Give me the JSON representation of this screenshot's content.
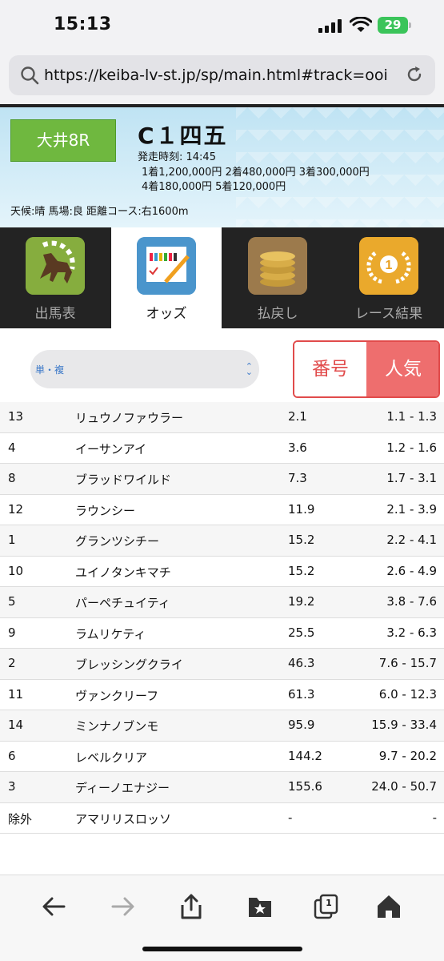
{
  "status": {
    "time": "15:13",
    "battery": "29"
  },
  "browser": {
    "url": "https://keiba-lv-st.jp/sp/main.html#track=ooi"
  },
  "race": {
    "badge": "大井8R",
    "name": "C１四五",
    "start": "発走時刻: 14:45",
    "prize_line1": "1着1,200,000円  2着480,000円  3着300,000円",
    "prize_line2": "4着180,000円  5着120,000円",
    "conditions": "天候:晴 馬場:良   距離コース:右1600m"
  },
  "tabs": [
    {
      "label": "出馬表",
      "icon": "horse-icon",
      "active": false
    },
    {
      "label": "オッズ",
      "icon": "odds-sheet-icon",
      "active": true
    },
    {
      "label": "払戻し",
      "icon": "coins-icon",
      "active": false
    },
    {
      "label": "レース結果",
      "icon": "trophy-icon",
      "active": false
    }
  ],
  "controls": {
    "bet_type": "単・複",
    "sort_number": "番号",
    "sort_popularity": "人気"
  },
  "odds_rows": [
    {
      "num": "13",
      "name": "リュウノファウラー",
      "win": "2.1",
      "place": "1.1 - 1.3"
    },
    {
      "num": "4",
      "name": "イーサンアイ",
      "win": "3.6",
      "place": "1.2 - 1.6"
    },
    {
      "num": "8",
      "name": "ブラッドワイルド",
      "win": "7.3",
      "place": "1.7 - 3.1"
    },
    {
      "num": "12",
      "name": "ラウンシー",
      "win": "11.9",
      "place": "2.1 - 3.9"
    },
    {
      "num": "1",
      "name": "グランツシチー",
      "win": "15.2",
      "place": "2.2 - 4.1"
    },
    {
      "num": "10",
      "name": "ユイノタンキマチ",
      "win": "15.2",
      "place": "2.6 - 4.9"
    },
    {
      "num": "5",
      "name": "パーペチュイティ",
      "win": "19.2",
      "place": "3.8 - 7.6"
    },
    {
      "num": "9",
      "name": "ラムリケティ",
      "win": "25.5",
      "place": "3.2 - 6.3"
    },
    {
      "num": "2",
      "name": "ブレッシングクライ",
      "win": "46.3",
      "place": "7.6 - 15.7"
    },
    {
      "num": "11",
      "name": "ヴァンクリーフ",
      "win": "61.3",
      "place": "6.0 - 12.3"
    },
    {
      "num": "14",
      "name": "ミンナノブンモ",
      "win": "95.9",
      "place": "15.9 - 33.4"
    },
    {
      "num": "6",
      "name": "レベルクリア",
      "win": "144.2",
      "place": "9.7 - 20.2"
    },
    {
      "num": "3",
      "name": "ディーノエナジー",
      "win": "155.6",
      "place": "24.0 - 50.7"
    },
    {
      "num": "除外",
      "name": "アマリリスロッソ",
      "win": "-",
      "place": "-"
    }
  ],
  "toolbar": {
    "tabs_count": "1"
  }
}
